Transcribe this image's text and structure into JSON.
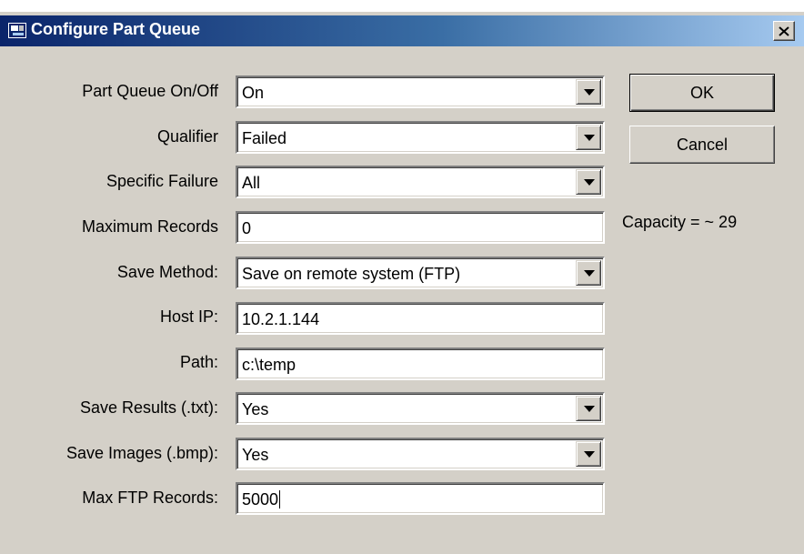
{
  "window": {
    "title": "Configure Part Queue",
    "title_icon": "app-icon",
    "close_icon": "close-icon"
  },
  "fields": [
    {
      "label": "Part Queue On/Off",
      "value": "On",
      "type": "dropdown"
    },
    {
      "label": "Qualifier",
      "value": "Failed",
      "type": "dropdown"
    },
    {
      "label": "Specific Failure",
      "value": "All",
      "type": "dropdown"
    },
    {
      "label": "Maximum Records",
      "value": "0",
      "type": "text"
    },
    {
      "label": "Save Method:",
      "value": "Save on remote system (FTP)",
      "type": "dropdown"
    },
    {
      "label": "Host IP:",
      "value": "10.2.1.144",
      "type": "text"
    },
    {
      "label": "Path:",
      "value": "c:\\temp",
      "type": "text"
    },
    {
      "label": "Save Results (.txt):",
      "value": "Yes",
      "type": "dropdown"
    },
    {
      "label": "Save Images (.bmp):",
      "value": "Yes",
      "type": "dropdown"
    },
    {
      "label": "Max FTP Records:",
      "value": "5000",
      "type": "text"
    }
  ],
  "buttons": {
    "ok": "OK",
    "cancel": "Cancel"
  },
  "capacity_text": "Capacity = ~ 29",
  "colors": {
    "dialog_bg": "#d4d0c8",
    "titlebar_start": "#0a246a",
    "titlebar_end": "#a6caf0",
    "title_text": "#ffffff"
  }
}
